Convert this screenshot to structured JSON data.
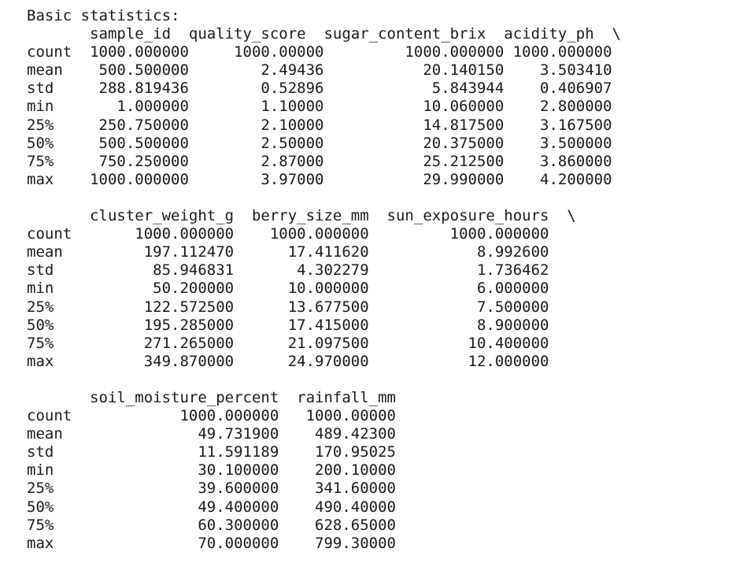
{
  "output": {
    "title": "Basic statistics:",
    "blocks": [
      {
        "header": "       sample_id  quality_score  sugar_content_brix  acidity_ph  \\",
        "rows": [
          "count  1000.000000     1000.00000         1000.000000 1000.000000",
          "mean    500.500000        2.49436           20.140150    3.503410",
          "std     288.819436        0.52896            5.843944    0.406907",
          "min       1.000000        1.10000           10.060000    2.800000",
          "25%     250.750000        2.10000           14.817500    3.167500",
          "50%     500.500000        2.50000           20.375000    3.500000",
          "75%     750.250000        2.87000           25.212500    3.860000",
          "max    1000.000000        3.97000           29.990000    4.200000"
        ]
      },
      {
        "header": "       cluster_weight_g  berry_size_mm  sun_exposure_hours  \\",
        "rows": [
          "count       1000.000000    1000.000000         1000.000000",
          "mean         197.112470      17.411620            8.992600",
          "std           85.946831       4.302279            1.736462",
          "min           50.200000      10.000000            6.000000",
          "25%          122.572500      13.677500            7.500000",
          "50%          195.285000      17.415000            8.900000",
          "75%          271.265000      21.097500           10.400000",
          "max          349.870000      24.970000           12.000000"
        ]
      },
      {
        "header": "       soil_moisture_percent  rainfall_mm",
        "rows": [
          "count            1000.000000   1000.00000",
          "mean               49.731900    489.42300",
          "std                11.591189    170.95025",
          "min                30.100000    200.10000",
          "25%                39.600000    341.60000",
          "50%                49.400000    490.40000",
          "75%                60.300000    628.65000",
          "max                70.000000    799.30000"
        ]
      }
    ]
  }
}
